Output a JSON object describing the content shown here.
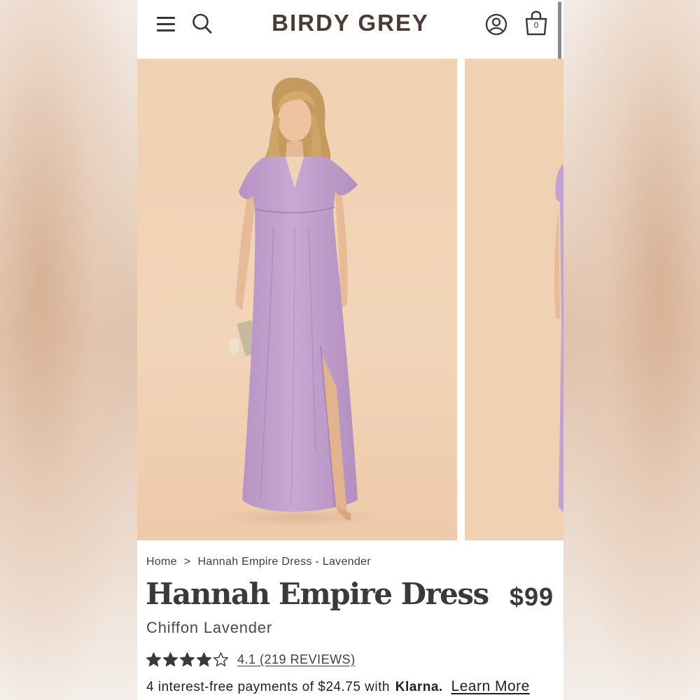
{
  "brand": {
    "logo_text": "BIRDY GREY"
  },
  "header": {
    "menu_icon": "hamburger-icon",
    "search_icon": "search-icon",
    "account_icon": "account-icon",
    "bag_icon": "shopping-bag-icon",
    "bag_count": "0"
  },
  "gallery": {
    "images": [
      {
        "description": "model-in-lavender-dress-front"
      },
      {
        "description": "model-in-lavender-dress-partial"
      }
    ]
  },
  "breadcrumb": {
    "items": [
      "Home",
      "Hannah Empire Dress - Lavender"
    ],
    "separator": ">"
  },
  "product": {
    "title": "Hannah Empire Dress",
    "price": "$99",
    "subtitle": "Chiffon Lavender",
    "rating": {
      "value": 4.1,
      "max": 5,
      "stars_filled": 4,
      "link_text": "4.1 (219 REVIEWS)"
    },
    "payments": {
      "text": "4 interest-free payments of $24.75 with",
      "provider": "Klarna.",
      "link": "Learn More"
    }
  },
  "colors": {
    "text_dark": "#3a3a3a",
    "logo": "#4a3b35",
    "dress": "#c7a6d0",
    "backdrop": "#f1d2b4"
  }
}
